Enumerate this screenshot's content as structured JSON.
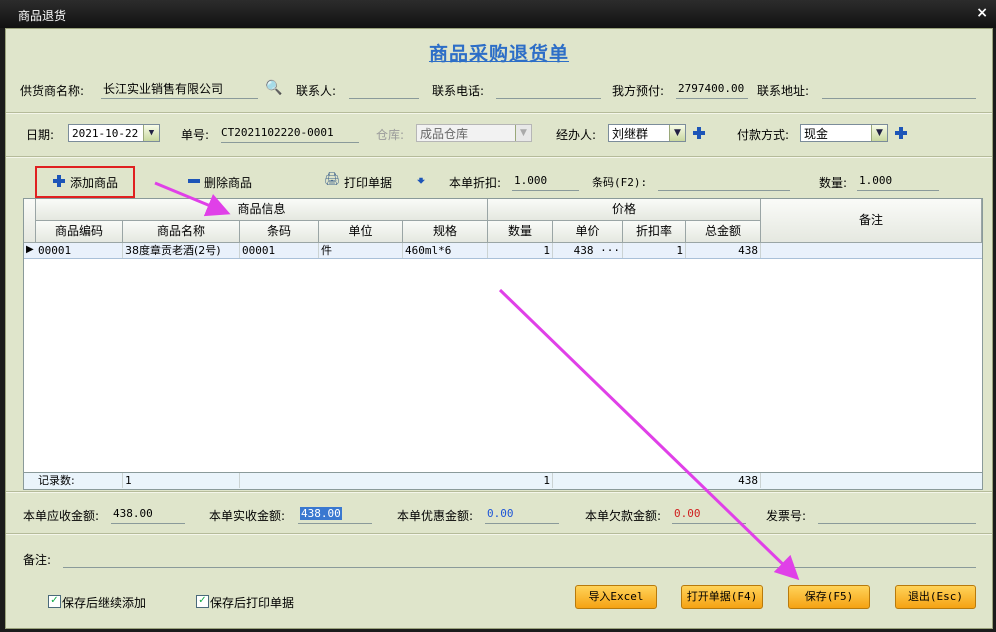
{
  "window": {
    "title": "商品退货",
    "close": "×"
  },
  "doc_title": "商品采购退货单",
  "header": {
    "supplier_label": "供货商名称:",
    "supplier": "长江实业销售有限公司",
    "contact_label": "联系人:",
    "contact": "",
    "phone_label": "联系电话:",
    "phone": "",
    "prepay_label": "我方预付:",
    "prepay": "2797400.00",
    "address_label": "联系地址:",
    "address": "",
    "date_label": "日期:",
    "date": "2021-10-22",
    "no_label": "单号:",
    "no": "CT2021102220-0001",
    "warehouse_label": "仓库:",
    "warehouse": "成品仓库",
    "handler_label": "经办人:",
    "handler": "刘继群",
    "pay_label": "付款方式:",
    "pay": "现金"
  },
  "toolbar": {
    "add": "添加商品",
    "delete": "删除商品",
    "print": "打印单据",
    "discount_label": "本单折扣:",
    "discount": "1.000",
    "barcode_label": "条码(F2):",
    "barcode": "",
    "qty_label": "数量:",
    "qty": "1.000"
  },
  "grid": {
    "group_product": "商品信息",
    "group_price": "价格",
    "remark": "备注",
    "columns": [
      "商品编码",
      "商品名称",
      "条码",
      "单位",
      "规格",
      "数量",
      "单价",
      "折扣率",
      "总金额"
    ],
    "rows": [
      {
        "code": "00001",
        "name": "38度章贡老酒(2号)",
        "barcode": "00001",
        "unit": "件",
        "spec": "460ml*6",
        "qty": "1",
        "price": "438 ···",
        "rate": "1",
        "total": "438"
      }
    ],
    "summary": {
      "label": "记录数:",
      "count": "1",
      "qty": "1",
      "total": "438"
    }
  },
  "footer": {
    "receivable_label": "本单应收金额:",
    "receivable": "438.00",
    "received_label": "本单实收金额:",
    "received": "438.00",
    "discount_amt_label": "本单优惠金额:",
    "discount_amt": "0.00",
    "owed_label": "本单欠款金额:",
    "owed": "0.00",
    "invoice_label": "发票号:",
    "invoice": "",
    "remark_label": "备注:",
    "remark": "",
    "continue_add": "保存后继续添加",
    "print_after": "保存后打印单据",
    "btn_excel": "导入Excel",
    "btn_open": "打开单据(F4)",
    "btn_save": "保存(F5)",
    "btn_exit": "退出(Esc)"
  },
  "colors": {
    "accent": "#2d6ec7",
    "annotation": "#e040e8",
    "highlight_box": "#e02020"
  }
}
